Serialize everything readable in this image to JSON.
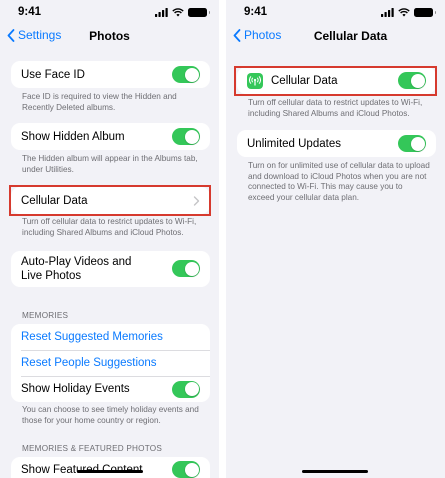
{
  "status_bar": {
    "time": "9:41"
  },
  "left": {
    "nav": {
      "back_label": "Settings",
      "title": "Photos"
    },
    "face_id": {
      "label": "Use Face ID",
      "on": true,
      "footnote": "Face ID is required to view the Hidden and Recently Deleted albums."
    },
    "hidden_album": {
      "label": "Show Hidden Album",
      "on": true,
      "footnote": "The Hidden album will appear in the Albums tab, under Utilities."
    },
    "cellular": {
      "label": "Cellular Data",
      "footnote": "Turn off cellular data to restrict updates to Wi-Fi, including Shared Albums and iCloud Photos."
    },
    "autoplay": {
      "label_line1": "Auto-Play Videos and",
      "label_line2": "Live Photos",
      "on": true
    },
    "memories": {
      "header": "MEMORIES",
      "reset_suggested": "Reset Suggested Memories",
      "reset_people": "Reset People Suggestions",
      "holiday_label": "Show Holiday Events",
      "holiday_on": true,
      "footnote": "You can choose to see timely holiday events and those for your home country or region."
    },
    "featured": {
      "header": "MEMORIES & FEATURED PHOTOS",
      "label": "Show Featured Content",
      "on": true
    }
  },
  "right": {
    "nav": {
      "back_label": "Photos",
      "title": "Cellular Data"
    },
    "cellular": {
      "label": "Cellular Data",
      "on": true,
      "icon": "cellular-antenna-icon",
      "footnote": "Turn off cellular data to restrict updates to Wi-Fi, including Shared Albums and iCloud Photos."
    },
    "unlimited": {
      "label": "Unlimited Updates",
      "on": true,
      "footnote": "Turn on for unlimited use of cellular data to upload and download to iCloud Photos when you are not connected to Wi-Fi. This may cause you to exceed your cellular data plan."
    }
  },
  "colors": {
    "accent": "#0a7aff",
    "toggle_on": "#34c759",
    "highlight": "#d63a2e",
    "background": "#f2f2f7"
  }
}
